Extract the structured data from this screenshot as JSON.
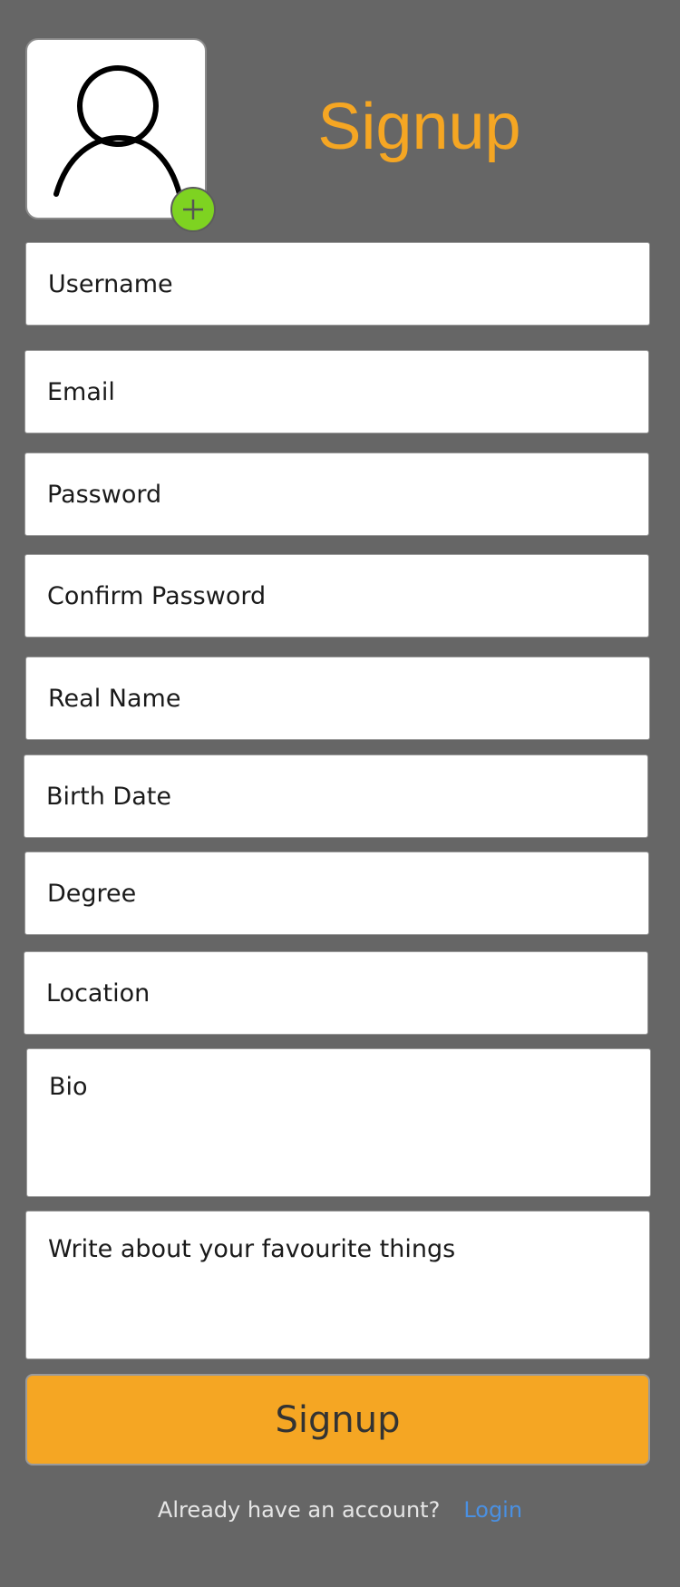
{
  "header": {
    "title": "Signup"
  },
  "avatar": {
    "placeholder_icon": "user-icon",
    "add_icon": "plus-icon",
    "add_button_color": "#7ed321"
  },
  "fields": {
    "username": "Username",
    "email": "Email",
    "password": "Password",
    "confirm_password": "Confirm Password",
    "real_name": "Real Name",
    "birth_date": "Birth Date",
    "degree": "Degree",
    "location": "Location",
    "bio": "Bio",
    "favourites": "Write about your favourite things"
  },
  "actions": {
    "signup_label": "Signup"
  },
  "footer": {
    "question": "Already have an account?",
    "login_label": "Login"
  },
  "colors": {
    "background": "#666666",
    "accent": "#f5a623",
    "link": "#4a90e2"
  }
}
